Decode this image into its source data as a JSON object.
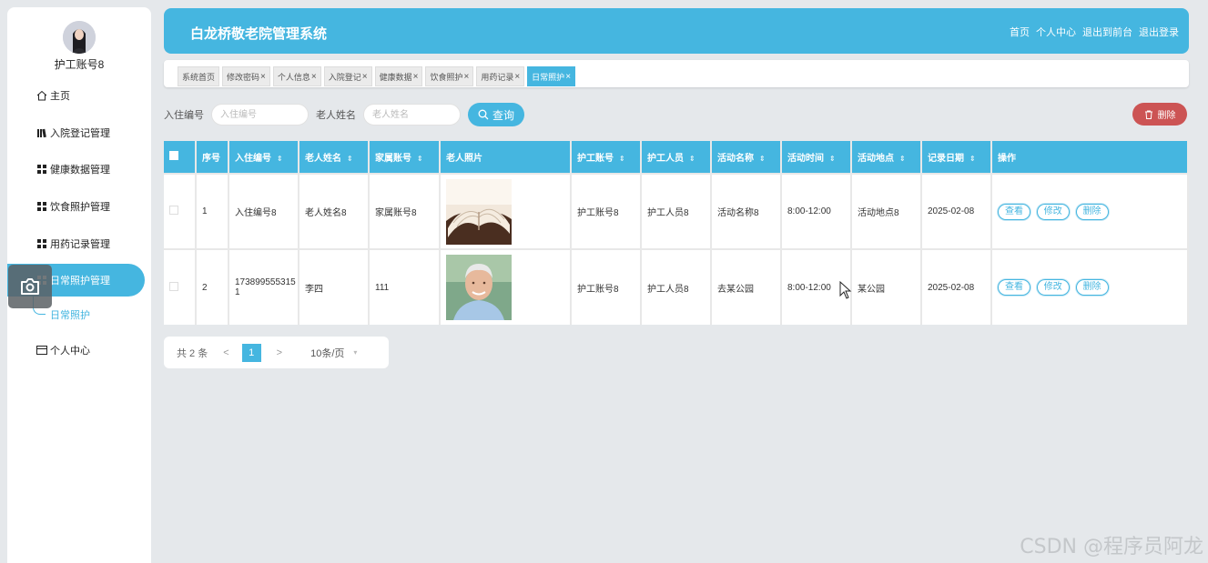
{
  "sidebar": {
    "username": "护工账号8",
    "items": [
      {
        "label": "主页",
        "icon": "home-icon"
      },
      {
        "label": "入院登记管理",
        "icon": "book-icon"
      },
      {
        "label": "健康数据管理",
        "icon": "grid-icon"
      },
      {
        "label": "饮食照护管理",
        "icon": "grid-icon"
      },
      {
        "label": "用药记录管理",
        "icon": "grid-icon"
      },
      {
        "label": "日常照护管理",
        "icon": "grid-icon",
        "active": true
      },
      {
        "label": "个人中心",
        "icon": "card-icon"
      }
    ],
    "sub_item": "日常照护"
  },
  "header": {
    "title": "白龙桥敬老院管理系统",
    "links": [
      "首页",
      "个人中心",
      "退出到前台",
      "退出登录"
    ]
  },
  "tabs": [
    {
      "label": "系统首页",
      "closable": false
    },
    {
      "label": "修改密码",
      "closable": true
    },
    {
      "label": "个人信息",
      "closable": true
    },
    {
      "label": "入院登记",
      "closable": true
    },
    {
      "label": "健康数据",
      "closable": true
    },
    {
      "label": "饮食照护",
      "closable": true
    },
    {
      "label": "用药记录",
      "closable": true
    },
    {
      "label": "日常照护",
      "closable": true,
      "active": true
    }
  ],
  "search": {
    "field1_label": "入住编号",
    "field1_placeholder": "入住编号",
    "field2_label": "老人姓名",
    "field2_placeholder": "老人姓名",
    "query_label": "查询",
    "delete_label": "删除"
  },
  "table": {
    "columns": [
      "序号",
      "入住编号",
      "老人姓名",
      "家属账号",
      "老人照片",
      "护工账号",
      "护工人员",
      "活动名称",
      "活动时间",
      "活动地点",
      "记录日期",
      "操作"
    ],
    "sortable": [
      false,
      true,
      true,
      true,
      false,
      true,
      true,
      true,
      true,
      true,
      true,
      false
    ],
    "rows": [
      {
        "index": "1",
        "checkin_no": "入住编号8",
        "name": "老人姓名8",
        "family": "家属账号8",
        "photo": "book-photo",
        "worker_account": "护工账号8",
        "worker": "护工人员8",
        "activity": "活动名称8",
        "time": "8:00-12:00",
        "place": "活动地点8",
        "date": "2025-02-08"
      },
      {
        "index": "2",
        "checkin_no": "1738995553151",
        "name": "李四",
        "family": "111",
        "photo": "elderly-man-photo",
        "worker_account": "护工账号8",
        "worker": "护工人员8",
        "activity": "去某公园",
        "time": "8:00-12:00",
        "place": "某公园",
        "date": "2025-02-08"
      }
    ],
    "actions": [
      "查看",
      "修改",
      "删除"
    ]
  },
  "pager": {
    "total": "共 2 条",
    "prev": "<",
    "current": "1",
    "next": ">",
    "size": "10条/页"
  },
  "watermark": "CSDN @程序员阿龙",
  "colors": {
    "accent": "#45b6e0",
    "danger": "#cc5454",
    "background": "#e5e8eb"
  }
}
